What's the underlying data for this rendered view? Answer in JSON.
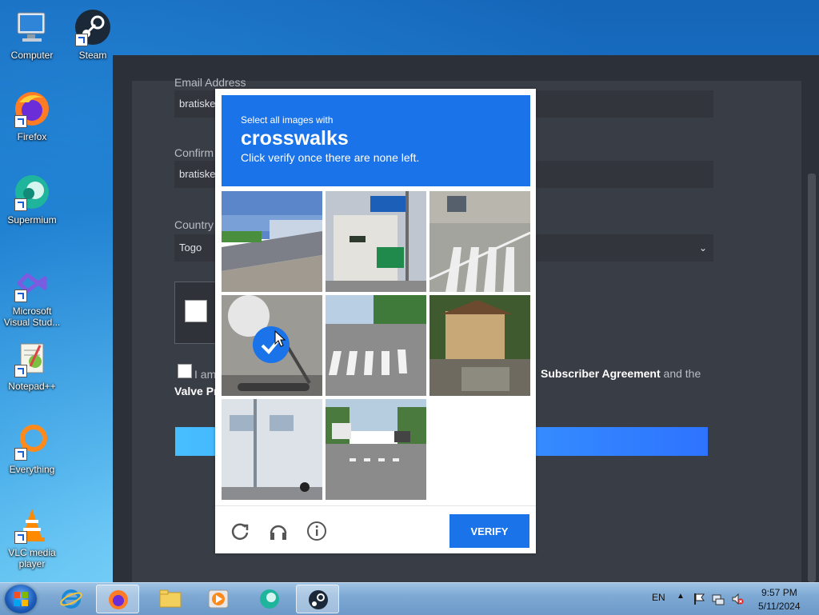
{
  "desktop": {
    "icons": [
      {
        "label": "Computer"
      },
      {
        "label": "Steam"
      },
      {
        "label": "Firefox"
      },
      {
        "label": "Supermium"
      },
      {
        "label": "Microsoft Visual Stud..."
      },
      {
        "label": "Notepad++"
      },
      {
        "label": "Everything"
      },
      {
        "label": "VLC media player"
      }
    ]
  },
  "steam_form": {
    "email_label": "Email Address",
    "email_value": "bratiske",
    "confirm_label": "Confirm",
    "confirm_value": "bratiske",
    "country_label": "Country",
    "country_value": "Togo",
    "agree_prefix": "I am",
    "agree_link": "Subscriber Agreement",
    "agree_suffix": "and the",
    "agree_line2": "Valve Pr"
  },
  "captcha": {
    "instruction": "Select all images with",
    "target": "crosswalks",
    "subtext": "Click verify once there are none left.",
    "verify_label": "VERIFY",
    "tiles": [
      {
        "scene": "street barrier",
        "selected": false
      },
      {
        "scene": "traffic light sign",
        "selected": false
      },
      {
        "scene": "crosswalk road",
        "selected": false
      },
      {
        "scene": "motorcycle",
        "selected": true
      },
      {
        "scene": "crosswalk street",
        "selected": false
      },
      {
        "scene": "house garden",
        "selected": false
      },
      {
        "scene": "building cyclist",
        "selected": false
      },
      {
        "scene": "street intersection",
        "selected": false
      }
    ]
  },
  "taskbar": {
    "language": "EN",
    "time": "9:57 PM",
    "date": "5/11/2024"
  },
  "colors": {
    "captcha_blue": "#1a73e8",
    "steam_bg": "#393d45"
  }
}
